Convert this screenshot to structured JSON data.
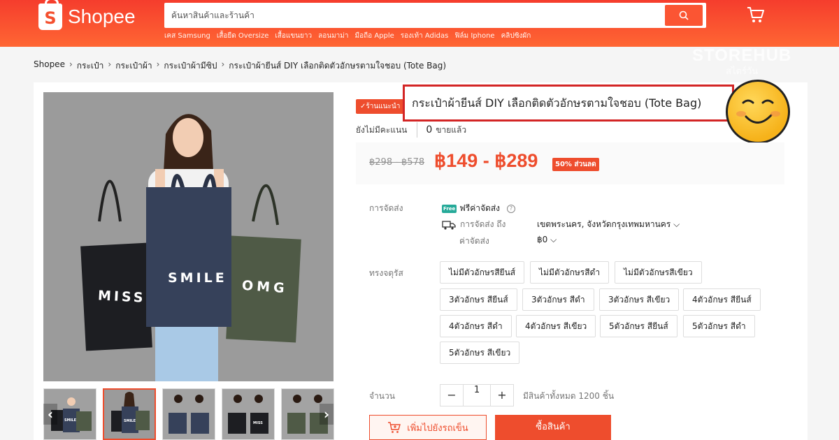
{
  "header": {
    "logo_text": "Shopee",
    "logo_letter": "S",
    "search_placeholder": "ค้นหาสินค้าและร้านค้า",
    "keywords": [
      "เคส Samsung",
      "เสื้อยืด Oversize",
      "เสื้อแขนยาว",
      "ลอนมาม่า",
      "มือถือ Apple",
      "รองเท้า Adidas",
      "ฟิล์ม Iphone",
      "คลิปซิงผัก"
    ],
    "accent_color": "#ee4d2d"
  },
  "breadcrumb": [
    "Shopee",
    "กระเป๋า",
    "กระเป๋าผ้า",
    "กระเป๋าผ้ามีซิป",
    "กระเป๋าผ้ายีนส์ DIY เลือกติดตัวอักษรตามใจชอบ (Tote Bag)"
  ],
  "watermark": {
    "line1": "STOREHUB",
    "line2": "สไตร์วัน"
  },
  "product": {
    "badge": "✓ร้านแนะนำ",
    "title": "กระเป๋าผ้ายีนส์ DIY เลือกติดตัวอักษรตามใจชอบ (Tote Bag)",
    "rating_text": "ยังไม่มีคะแนน",
    "sold_count": "0",
    "sold_label": "ขายแล้ว",
    "price_old": "฿298 - ฿578",
    "price_new": "฿149 - ฿289",
    "discount": "50% ส่วนลด",
    "bag_texts": [
      "MISS",
      "SMILE",
      "OMG"
    ]
  },
  "shipping": {
    "label": "การจัดส่ง",
    "free_tag": "Free",
    "free_text": "ฟรีค่าจัดส่ง",
    "ship_to_label": "การจัดส่ง ถึง",
    "destination": "เขตพระนคร, จังหวัดกรุงเทพมหานคร",
    "fee_label": "ค่าจัดส่ง",
    "fee_value": "฿0"
  },
  "variations": {
    "label": "ทรงจตุรัส",
    "options": [
      "ไม่มีตัวอักษรสียีนส์",
      "ไม่มีตัวอักษรสีดำ",
      "ไม่มีตัวอักษรสีเขียว",
      "3ตัวอักษร สียีนส์",
      "3ตัวอักษร สีดำ",
      "3ตัวอักษร สีเขียว",
      "4ตัวอักษร สียีนส์",
      "4ตัวอักษร สีดำ",
      "4ตัวอักษร สีเขียว",
      "5ตัวอักษร สียีนส์",
      "5ตัวอักษร สีดำ",
      "5ตัวอักษร สีเขียว"
    ]
  },
  "quantity": {
    "label": "จำนวน",
    "minus": "−",
    "value": "1",
    "plus": "+",
    "stock": "มีสินค้าทั้งหมด 1200 ชิ้น"
  },
  "actions": {
    "add_to_cart": "เพิ่มไปยังรถเข็น",
    "buy_now": "ซื้อสินค้า"
  },
  "thumbnails": {
    "prev": "‹",
    "next": "›",
    "bag_texts": [
      "SMILE",
      "OMG",
      "MISS"
    ]
  }
}
